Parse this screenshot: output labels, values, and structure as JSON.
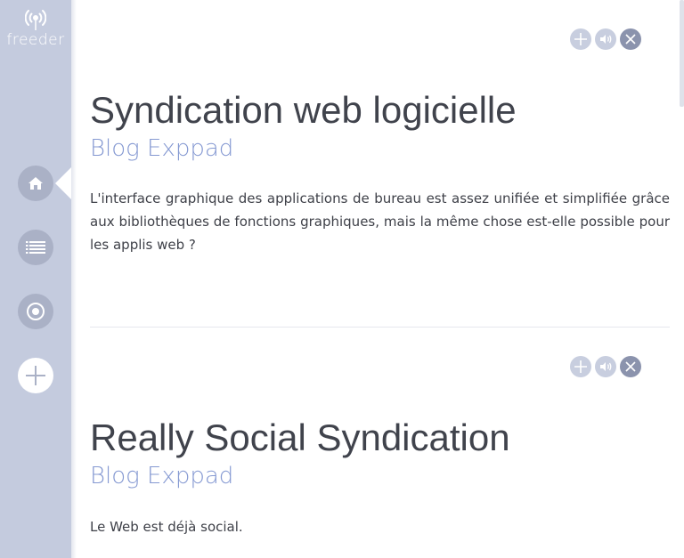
{
  "app": {
    "name": "freeder"
  },
  "sidebar": {
    "items": [
      {
        "name": "home",
        "icon": "home-icon",
        "active": true
      },
      {
        "name": "list",
        "icon": "list-icon",
        "active": false
      },
      {
        "name": "feeds",
        "icon": "target-icon",
        "active": false
      },
      {
        "name": "add",
        "icon": "plus-icon",
        "active": false
      }
    ]
  },
  "articles": [
    {
      "title": "Syndication web logicielle",
      "source": "Blog Exppad",
      "excerpt": "L'interface graphique des applications de bureau est assez unifiée et simplifiée grâce aux bibliothèques de fonctions graphiques, mais la même chose est-elle possible pour les applis web ?",
      "actions": [
        "add-icon",
        "read-aloud-icon",
        "close-icon"
      ]
    },
    {
      "title": "Really Social Syndication",
      "source": "Blog Exppad",
      "excerpt": "Le Web est déjà social.",
      "actions": [
        "add-icon",
        "read-aloud-icon",
        "close-icon"
      ]
    }
  ],
  "colors": {
    "sidebar": "#c4cbde",
    "nav_button": "#aab1c6",
    "title": "#40434c",
    "source": "#8599d2",
    "action_light": "#c8cedf",
    "action_dark": "#8b93ad"
  }
}
